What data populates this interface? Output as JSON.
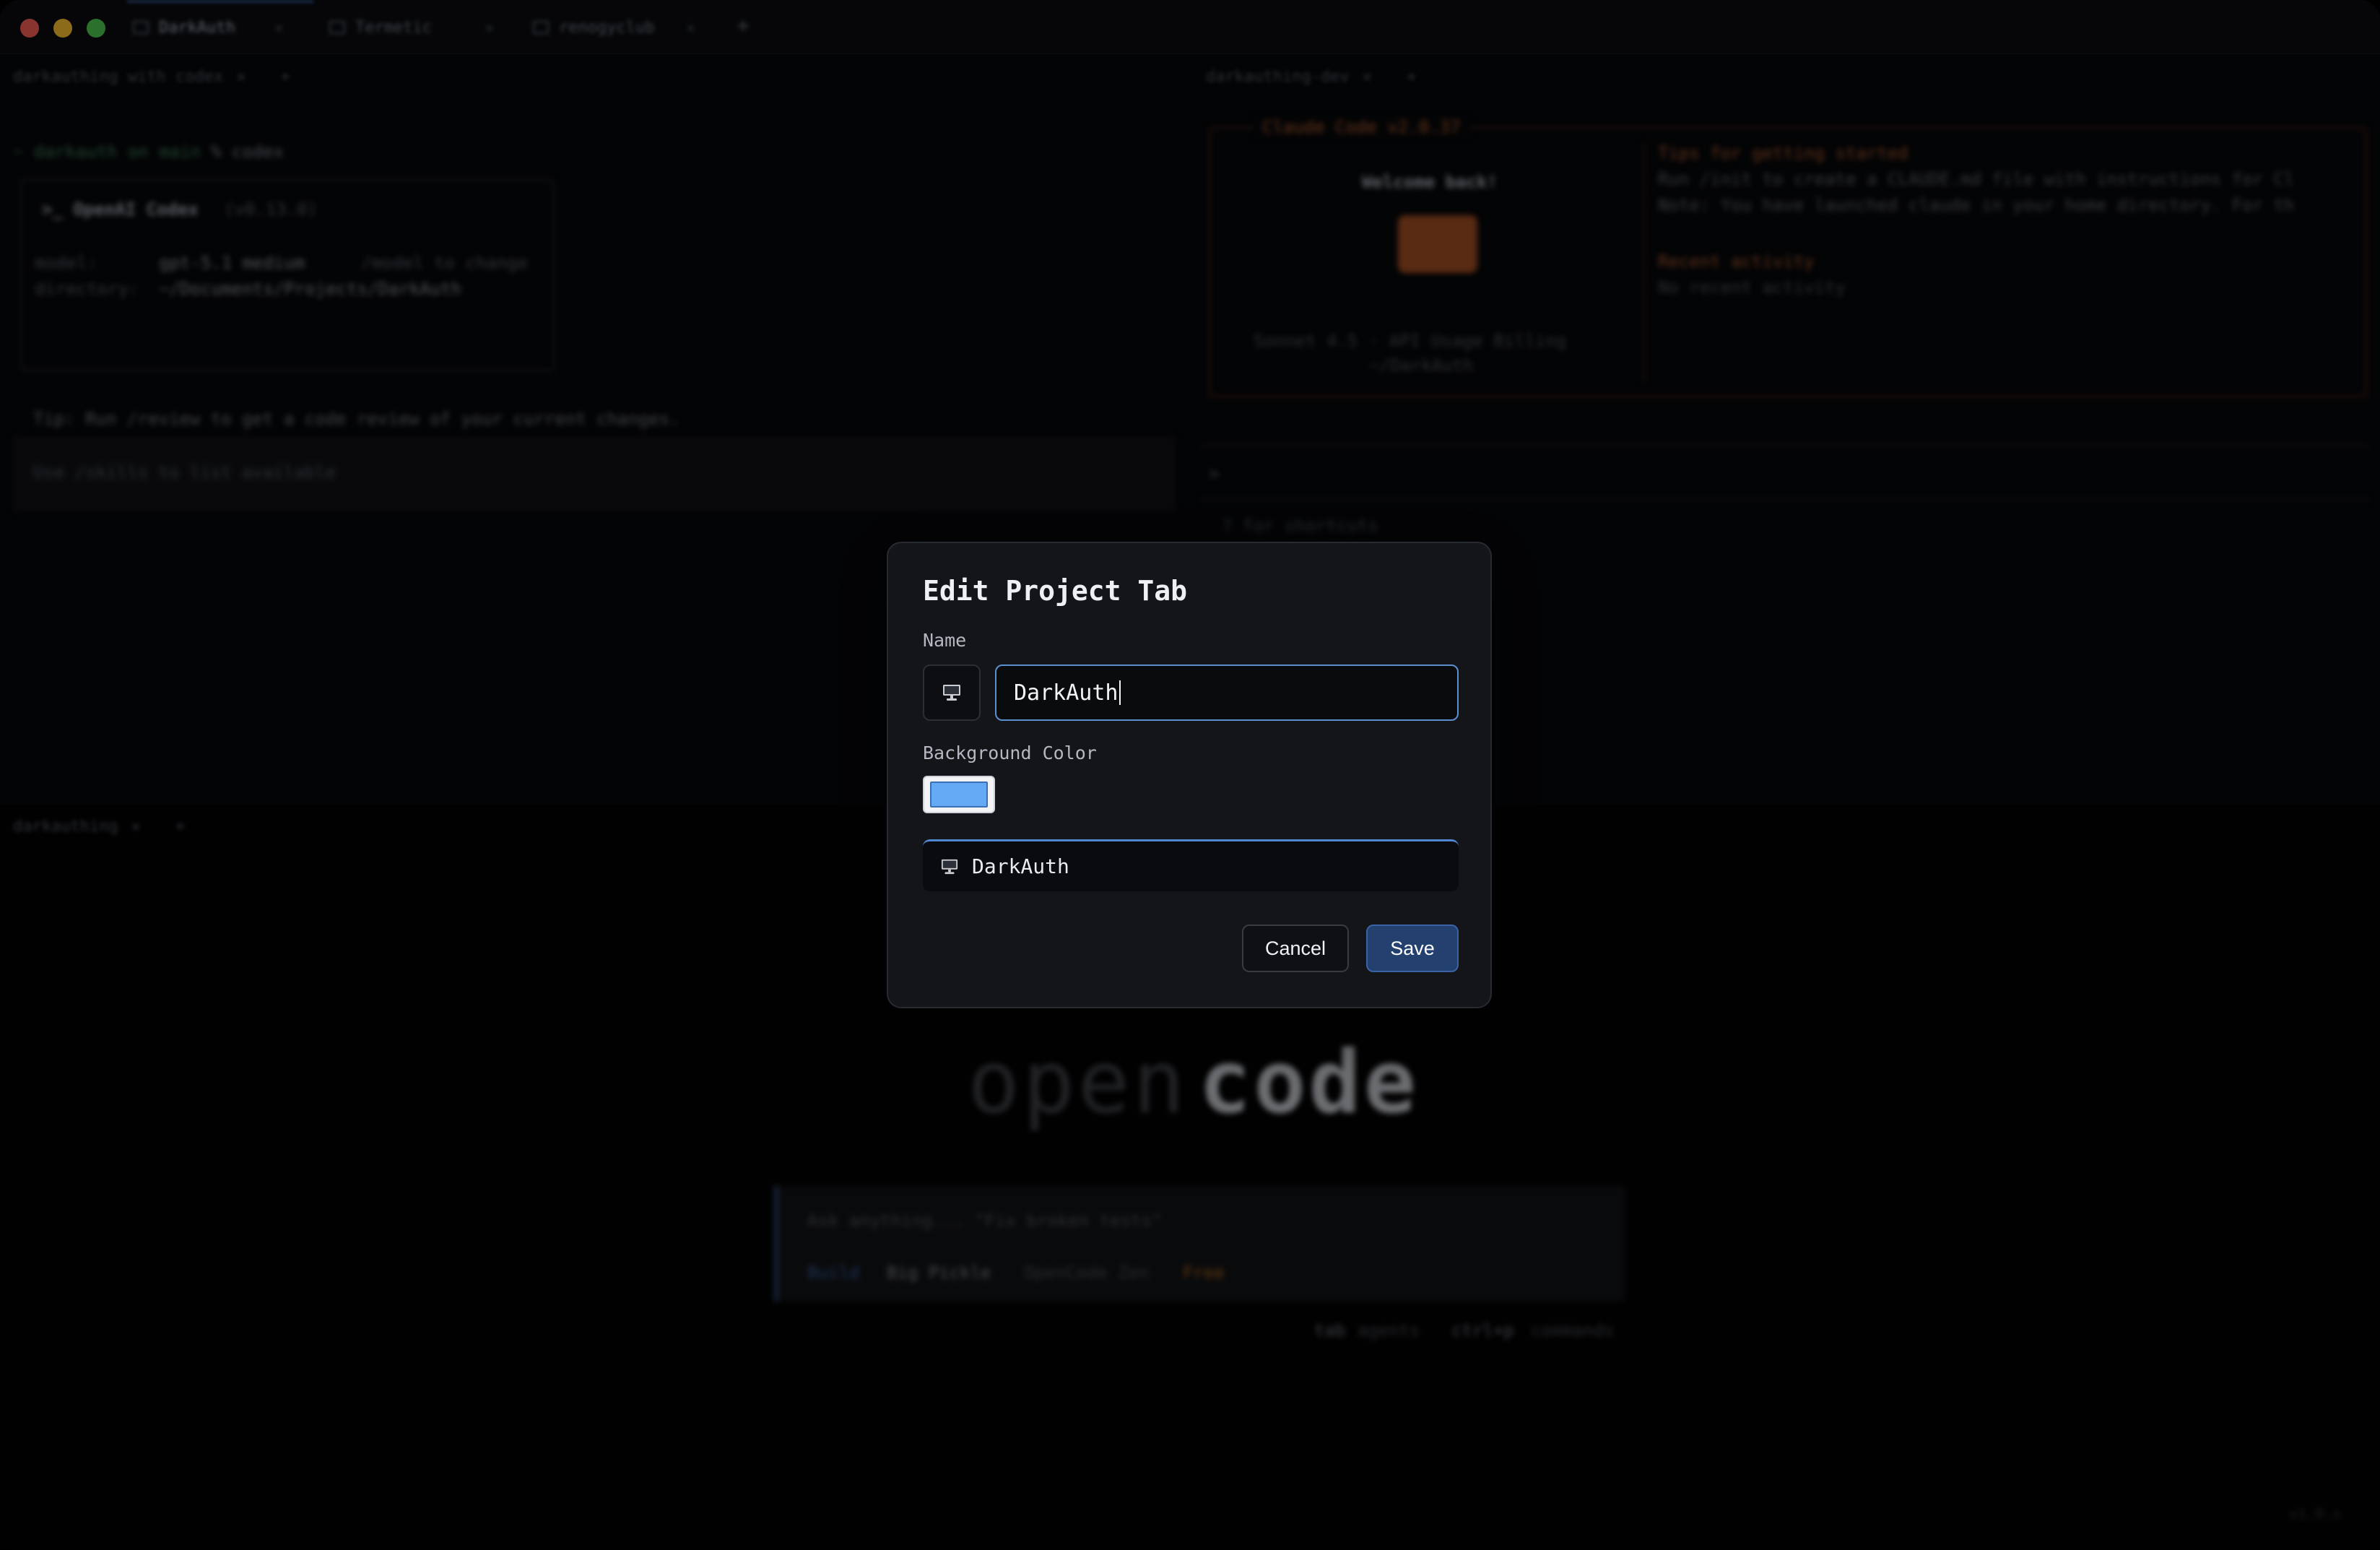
{
  "window": {
    "tabs": [
      {
        "label": "DarkAuth",
        "active": true
      },
      {
        "label": "Termetic",
        "active": false
      },
      {
        "label": "renogyclub",
        "active": false
      }
    ],
    "new_tab_label": "+"
  },
  "background": {
    "pane_top_left": {
      "tab_label": "darkauthing with codex",
      "prompt": "~ darkauth on  main",
      "prompt_tail": "% codex",
      "codex_title": ">_ OpenAI Codex",
      "codex_version": "(v0.13.0)",
      "model_key": "model:",
      "model_value": "gpt-5.1 medium",
      "model_hint": "/model to change",
      "directory_key": "directory:",
      "directory_value": "~/Documents/Projects/DarkAuth",
      "tip": "Tip: Run /review to get a code review of your current changes.",
      "input_placeholder": "Use /skills to list available"
    },
    "pane_top_right": {
      "tab_label": "darkauthing-dev",
      "box_title": "Claude Code v2.0.37",
      "welcome": "Welcome back!",
      "model_line": "Sonnet 4.5 · API Usage Billing",
      "path_line": "~/DarkAuth",
      "tips_heading": "Tips for getting started",
      "tips_line1": "Run /init to create a CLAUDE.md file with instructions for Cl",
      "tips_line2": "Note: You have launched claude in your home directory. For th",
      "recent_heading": "Recent activity",
      "recent_value": "No recent activity",
      "prompt_char": ">",
      "shortcuts": "? for shortcuts"
    },
    "pane_bottom": {
      "tab_label": "darkauthing",
      "logo_light": "open",
      "logo_bold": "code",
      "input_hint": "Ask anything... \"Fix broken tests\"",
      "mode": "Build",
      "model": "Big Pickle",
      "provider": "OpenCode Zen",
      "badge": "Free",
      "footer_keys": [
        "tab",
        "agents",
        "ctrl+p",
        "commands"
      ],
      "version": "v1.0.x"
    }
  },
  "modal": {
    "title": "Edit Project Tab",
    "name_label": "Name",
    "name_value": "DarkAuth",
    "icon": "monitor-icon",
    "background_color_label": "Background Color",
    "background_color": "#64aaf5",
    "preview_label": "DarkAuth",
    "cancel_label": "Cancel",
    "save_label": "Save"
  }
}
